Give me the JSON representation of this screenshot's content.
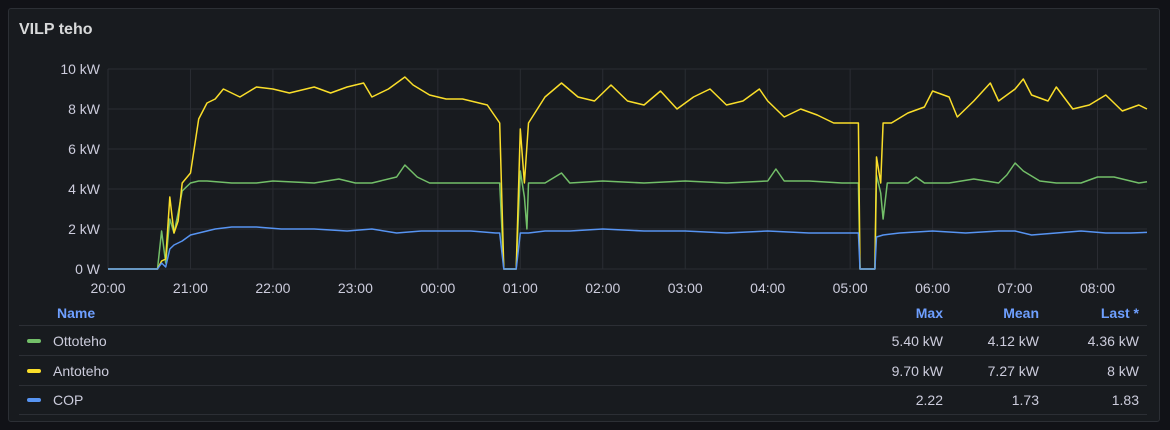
{
  "panel": {
    "title": "VILP teho"
  },
  "chart_data": {
    "type": "line",
    "title": "VILP teho",
    "x_ticks": [
      "20:00",
      "21:00",
      "22:00",
      "23:00",
      "00:00",
      "01:00",
      "02:00",
      "03:00",
      "04:00",
      "05:00",
      "06:00",
      "07:00",
      "08:00"
    ],
    "y_ticks": [
      "0 W",
      "2 kW",
      "4 kW",
      "6 kW",
      "8 kW",
      "10 kW"
    ],
    "x_range_hours": [
      0,
      12.6
    ],
    "ylim": [
      0,
      10
    ],
    "y_unit": "kW",
    "grid": true,
    "legend_position": "bottom",
    "series": [
      {
        "name": "Ottoteho",
        "color": "#73bf69",
        "points": [
          [
            0,
            0
          ],
          [
            0.6,
            0
          ],
          [
            0.65,
            1.9
          ],
          [
            0.7,
            0.3
          ],
          [
            0.75,
            2.5
          ],
          [
            0.8,
            1.8
          ],
          [
            0.85,
            2.8
          ],
          [
            0.9,
            3.9
          ],
          [
            0.95,
            4.1
          ],
          [
            1.0,
            4.3
          ],
          [
            1.1,
            4.4
          ],
          [
            1.2,
            4.4
          ],
          [
            1.5,
            4.3
          ],
          [
            1.8,
            4.3
          ],
          [
            2.0,
            4.4
          ],
          [
            2.5,
            4.3
          ],
          [
            2.8,
            4.5
          ],
          [
            3.0,
            4.3
          ],
          [
            3.2,
            4.3
          ],
          [
            3.5,
            4.6
          ],
          [
            3.6,
            5.2
          ],
          [
            3.75,
            4.6
          ],
          [
            3.9,
            4.3
          ],
          [
            4.2,
            4.3
          ],
          [
            4.6,
            4.3
          ],
          [
            4.75,
            4.3
          ],
          [
            4.8,
            0
          ],
          [
            4.95,
            0
          ],
          [
            5.0,
            4.9
          ],
          [
            5.05,
            3.6
          ],
          [
            5.08,
            2.0
          ],
          [
            5.1,
            4.3
          ],
          [
            5.3,
            4.3
          ],
          [
            5.5,
            4.8
          ],
          [
            5.6,
            4.3
          ],
          [
            6.0,
            4.4
          ],
          [
            6.5,
            4.3
          ],
          [
            7.0,
            4.4
          ],
          [
            7.5,
            4.3
          ],
          [
            8.0,
            4.4
          ],
          [
            8.1,
            5.0
          ],
          [
            8.2,
            4.4
          ],
          [
            8.5,
            4.4
          ],
          [
            8.9,
            4.3
          ],
          [
            9.1,
            4.3
          ],
          [
            9.12,
            0
          ],
          [
            9.3,
            0
          ],
          [
            9.32,
            4.7
          ],
          [
            9.37,
            3.8
          ],
          [
            9.4,
            2.5
          ],
          [
            9.45,
            4.3
          ],
          [
            9.7,
            4.3
          ],
          [
            9.8,
            4.6
          ],
          [
            9.9,
            4.3
          ],
          [
            10.2,
            4.3
          ],
          [
            10.5,
            4.5
          ],
          [
            10.8,
            4.3
          ],
          [
            10.9,
            4.7
          ],
          [
            11.0,
            5.3
          ],
          [
            11.1,
            4.9
          ],
          [
            11.3,
            4.4
          ],
          [
            11.5,
            4.3
          ],
          [
            11.8,
            4.3
          ],
          [
            12.0,
            4.6
          ],
          [
            12.2,
            4.6
          ],
          [
            12.5,
            4.3
          ],
          [
            12.6,
            4.36
          ]
        ]
      },
      {
        "name": "Antoteho",
        "color": "#fade2a",
        "points": [
          [
            0,
            0
          ],
          [
            0.6,
            0
          ],
          [
            0.65,
            0.4
          ],
          [
            0.7,
            0.5
          ],
          [
            0.75,
            3.6
          ],
          [
            0.8,
            1.8
          ],
          [
            0.85,
            2.4
          ],
          [
            0.9,
            4.3
          ],
          [
            1.0,
            4.8
          ],
          [
            1.1,
            7.5
          ],
          [
            1.2,
            8.3
          ],
          [
            1.3,
            8.5
          ],
          [
            1.4,
            9.0
          ],
          [
            1.6,
            8.6
          ],
          [
            1.8,
            9.1
          ],
          [
            2.0,
            9.0
          ],
          [
            2.2,
            8.8
          ],
          [
            2.5,
            9.1
          ],
          [
            2.7,
            8.8
          ],
          [
            2.9,
            9.1
          ],
          [
            3.1,
            9.3
          ],
          [
            3.2,
            8.6
          ],
          [
            3.4,
            9.0
          ],
          [
            3.6,
            9.6
          ],
          [
            3.7,
            9.2
          ],
          [
            3.9,
            8.7
          ],
          [
            4.1,
            8.5
          ],
          [
            4.3,
            8.5
          ],
          [
            4.5,
            8.3
          ],
          [
            4.6,
            8.2
          ],
          [
            4.75,
            7.3
          ],
          [
            4.8,
            0
          ],
          [
            4.95,
            0
          ],
          [
            5.0,
            7.0
          ],
          [
            5.05,
            4.3
          ],
          [
            5.1,
            7.3
          ],
          [
            5.3,
            8.6
          ],
          [
            5.5,
            9.3
          ],
          [
            5.7,
            8.6
          ],
          [
            5.9,
            8.4
          ],
          [
            6.1,
            9.2
          ],
          [
            6.3,
            8.4
          ],
          [
            6.5,
            8.2
          ],
          [
            6.7,
            8.9
          ],
          [
            6.9,
            8.0
          ],
          [
            7.1,
            8.6
          ],
          [
            7.3,
            9.0
          ],
          [
            7.5,
            8.2
          ],
          [
            7.7,
            8.4
          ],
          [
            7.9,
            9.0
          ],
          [
            8.0,
            8.4
          ],
          [
            8.2,
            7.6
          ],
          [
            8.4,
            8.0
          ],
          [
            8.6,
            7.7
          ],
          [
            8.8,
            7.3
          ],
          [
            8.9,
            7.3
          ],
          [
            9.1,
            7.3
          ],
          [
            9.12,
            0
          ],
          [
            9.3,
            0
          ],
          [
            9.32,
            5.6
          ],
          [
            9.37,
            4.3
          ],
          [
            9.4,
            7.3
          ],
          [
            9.5,
            7.3
          ],
          [
            9.7,
            7.8
          ],
          [
            9.9,
            8.1
          ],
          [
            10.0,
            8.9
          ],
          [
            10.2,
            8.6
          ],
          [
            10.3,
            7.6
          ],
          [
            10.5,
            8.4
          ],
          [
            10.7,
            9.3
          ],
          [
            10.8,
            8.4
          ],
          [
            11.0,
            9.0
          ],
          [
            11.1,
            9.5
          ],
          [
            11.2,
            8.7
          ],
          [
            11.4,
            8.4
          ],
          [
            11.5,
            9.1
          ],
          [
            11.7,
            8.0
          ],
          [
            11.9,
            8.2
          ],
          [
            12.1,
            8.7
          ],
          [
            12.3,
            7.9
          ],
          [
            12.5,
            8.2
          ],
          [
            12.6,
            8.0
          ]
        ]
      },
      {
        "name": "COP",
        "color": "#5794f2",
        "points": [
          [
            0,
            0
          ],
          [
            0.6,
            0
          ],
          [
            0.65,
            0.3
          ],
          [
            0.7,
            0.1
          ],
          [
            0.75,
            1.0
          ],
          [
            0.8,
            1.2
          ],
          [
            0.9,
            1.4
          ],
          [
            1.0,
            1.7
          ],
          [
            1.1,
            1.8
          ],
          [
            1.3,
            2.0
          ],
          [
            1.5,
            2.1
          ],
          [
            1.8,
            2.1
          ],
          [
            2.1,
            2.0
          ],
          [
            2.5,
            2.0
          ],
          [
            2.9,
            1.9
          ],
          [
            3.2,
            2.0
          ],
          [
            3.5,
            1.8
          ],
          [
            3.8,
            1.9
          ],
          [
            4.1,
            1.9
          ],
          [
            4.4,
            1.9
          ],
          [
            4.7,
            1.8
          ],
          [
            4.75,
            1.8
          ],
          [
            4.8,
            0
          ],
          [
            4.95,
            0
          ],
          [
            5.0,
            1.8
          ],
          [
            5.1,
            1.8
          ],
          [
            5.3,
            1.9
          ],
          [
            5.6,
            1.9
          ],
          [
            6.0,
            2.0
          ],
          [
            6.5,
            1.9
          ],
          [
            7.0,
            1.9
          ],
          [
            7.5,
            1.8
          ],
          [
            8.0,
            1.9
          ],
          [
            8.5,
            1.8
          ],
          [
            8.9,
            1.8
          ],
          [
            9.1,
            1.8
          ],
          [
            9.12,
            0
          ],
          [
            9.3,
            0
          ],
          [
            9.32,
            1.6
          ],
          [
            9.4,
            1.7
          ],
          [
            9.6,
            1.8
          ],
          [
            10.0,
            1.9
          ],
          [
            10.4,
            1.8
          ],
          [
            10.8,
            1.9
          ],
          [
            11.0,
            1.9
          ],
          [
            11.2,
            1.7
          ],
          [
            11.5,
            1.8
          ],
          [
            11.8,
            1.9
          ],
          [
            12.1,
            1.8
          ],
          [
            12.4,
            1.8
          ],
          [
            12.6,
            1.83
          ]
        ]
      }
    ]
  },
  "legend": {
    "headers": {
      "name": "Name",
      "max": "Max",
      "mean": "Mean",
      "last": "Last *"
    },
    "rows": [
      {
        "name": "Ottoteho",
        "color": "#73bf69",
        "max": "5.40 kW",
        "mean": "4.12 kW",
        "last": "4.36 kW"
      },
      {
        "name": "Antoteho",
        "color": "#fade2a",
        "max": "9.70 kW",
        "mean": "7.27 kW",
        "last": "8 kW"
      },
      {
        "name": "COP",
        "color": "#5794f2",
        "max": "2.22",
        "mean": "1.73",
        "last": "1.83"
      }
    ]
  }
}
